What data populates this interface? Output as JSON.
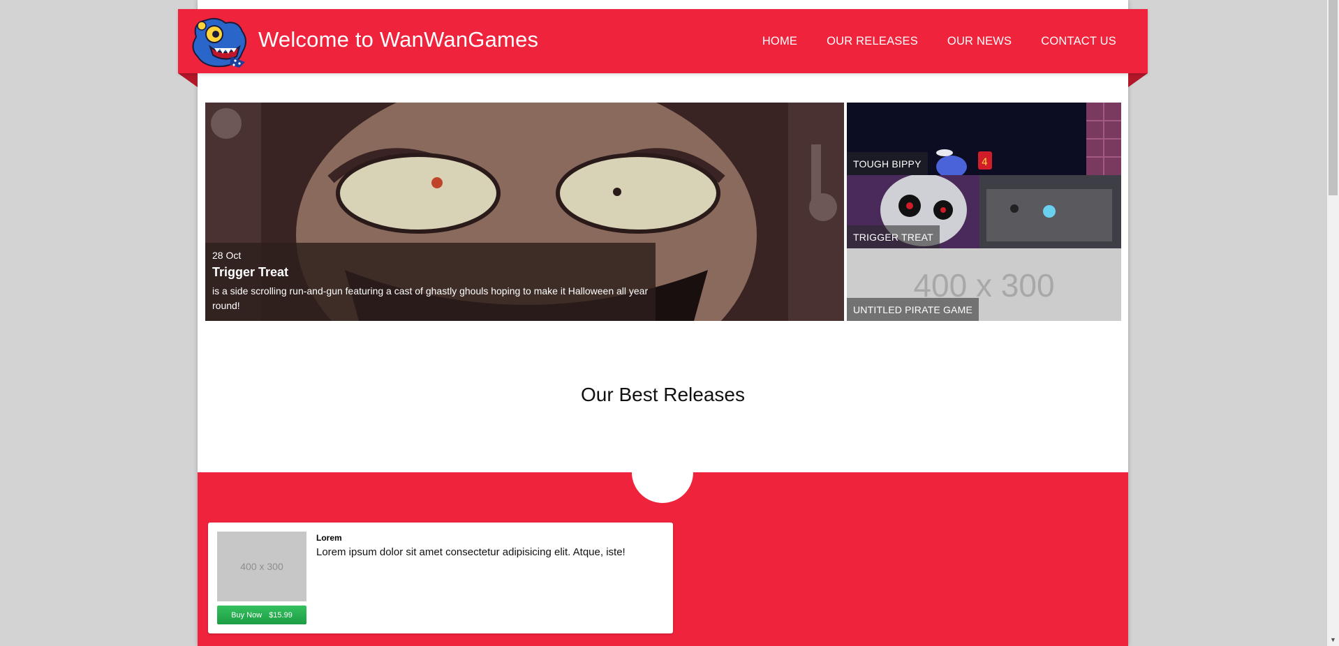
{
  "header": {
    "site_title": "Welcome to WanWanGames",
    "nav": [
      "HOME",
      "OUR RELEASES",
      "OUR NEWS",
      "CONTACT US"
    ],
    "logo_icon": "monster-mascot-icon",
    "accent_color": "#ef233c"
  },
  "hero": {
    "date": "28 Oct",
    "title": "Trigger Treat",
    "description": "is a side scrolling run-and-gun featuring a cast of ghastly ghouls hoping to make it Halloween all year round!"
  },
  "thumbnails": [
    {
      "label": "TOUGH BIPPY"
    },
    {
      "label": "TRIGGER TREAT"
    },
    {
      "label": "UNTITLED PIRATE GAME",
      "placeholder": "400 x 300"
    }
  ],
  "best_releases": {
    "title": "Our Best Releases",
    "card": {
      "image_placeholder": "400 x 300",
      "title": "Lorem",
      "description": "Lorem ipsum dolor sit amet consectetur adipisicing elit. Atque, iste!",
      "buy_label": "Buy Now",
      "price": "$15.99"
    }
  }
}
